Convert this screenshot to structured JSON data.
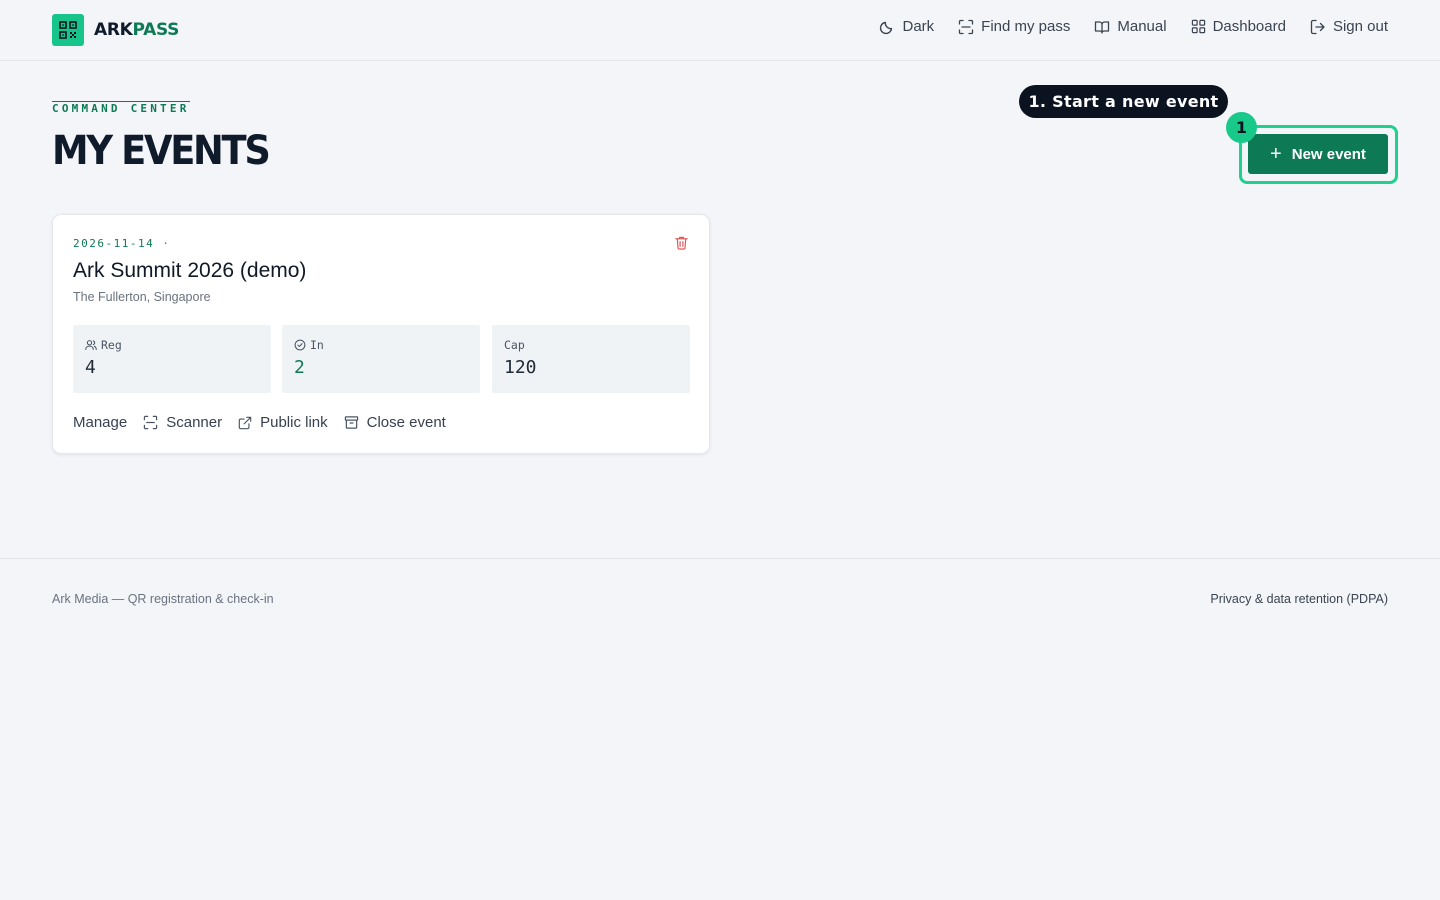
{
  "brand": {
    "name_part1": "ARK",
    "name_part2": "PASS"
  },
  "nav": [
    {
      "label": "Dark",
      "icon": "moon-icon"
    },
    {
      "label": "Find my pass",
      "icon": "scan-icon"
    },
    {
      "label": "Manual",
      "icon": "book-icon"
    },
    {
      "label": "Dashboard",
      "icon": "grid-icon"
    },
    {
      "label": "Sign out",
      "icon": "logout-icon"
    }
  ],
  "page": {
    "kicker": "COMMAND CENTER",
    "title": "MY EVENTS"
  },
  "guide": {
    "tooltip": "1. Start a new event",
    "step": "1"
  },
  "new_event_button": {
    "icon": "plus",
    "label": "New event"
  },
  "event_card": {
    "date": "2026-11-14",
    "separator": "·",
    "title": "Ark Summit 2026 (demo)",
    "venue": "The Fullerton, Singapore",
    "stats": [
      {
        "label": "Reg",
        "value": "4",
        "icon": "users-icon"
      },
      {
        "label": "In",
        "value": "2",
        "icon": "check-circle-icon"
      },
      {
        "label": "Cap",
        "value": "120"
      }
    ],
    "actions": [
      {
        "label": "Manage"
      },
      {
        "label": "Scanner",
        "icon": "scan-icon"
      },
      {
        "label": "Public link",
        "icon": "external-link-icon"
      },
      {
        "label": "Close event",
        "icon": "archive-icon"
      }
    ]
  },
  "footer": {
    "left": "Ark Media — QR registration & check-in",
    "right": "Privacy & data retention (PDPA)"
  },
  "colors": {
    "accent": "#0e7a55",
    "accent_bright": "#17c58a",
    "delete": "#e05a5a"
  }
}
